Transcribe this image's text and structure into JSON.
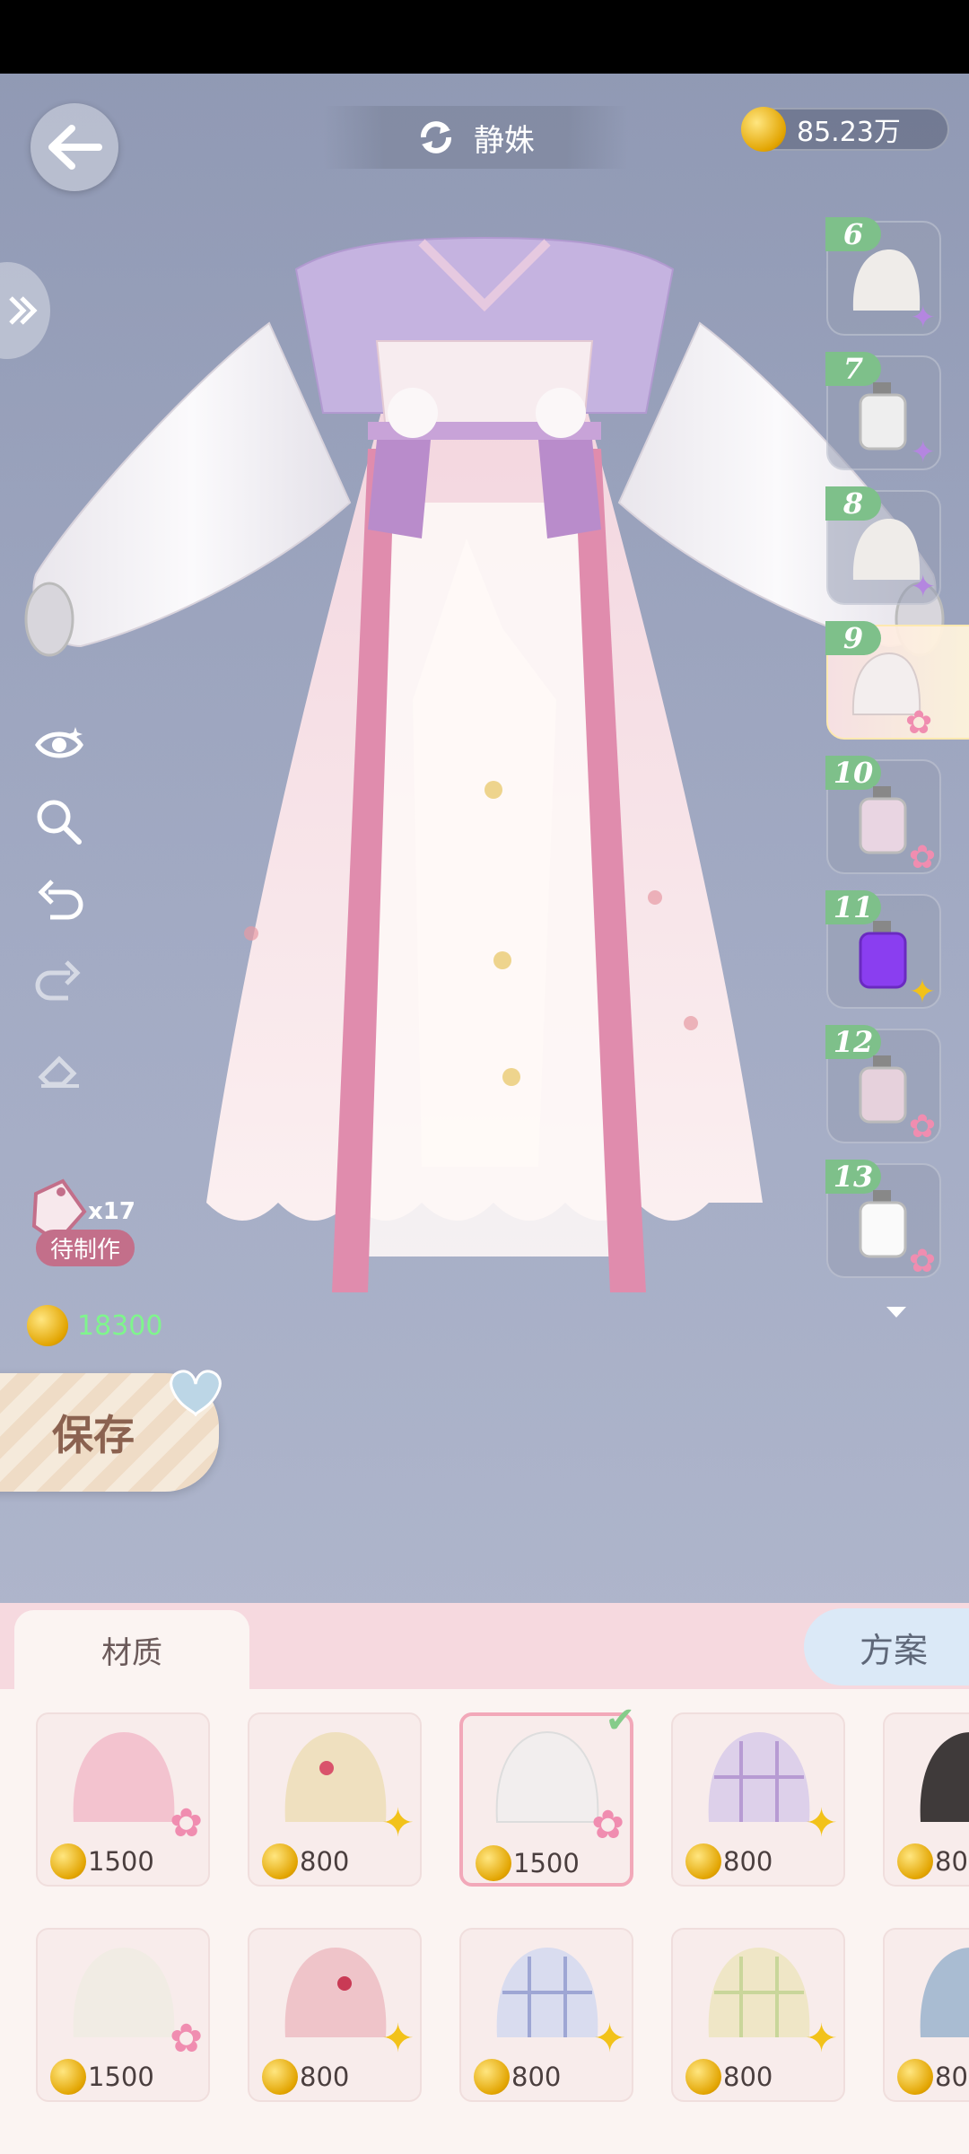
{
  "header": {
    "title": "静姝",
    "coin_balance": "85.23万"
  },
  "left_tools": {
    "craft_count": "x17",
    "craft_label": "待制作",
    "cost": "18300",
    "save_label": "保存"
  },
  "rail": {
    "slots": [
      {
        "num": "6",
        "item": "cape",
        "rarity": "purple"
      },
      {
        "num": "7",
        "item": "bottle",
        "rarity": "purple"
      },
      {
        "num": "8",
        "item": "cape",
        "rarity": "purple"
      },
      {
        "num": "9",
        "item": "shirt",
        "rarity": "rainbow",
        "selected": true
      },
      {
        "num": "10",
        "item": "bottle",
        "rarity": "rainbow"
      },
      {
        "num": "11",
        "item": "bottle",
        "rarity": "gold"
      },
      {
        "num": "12",
        "item": "bottle",
        "rarity": "rainbow"
      },
      {
        "num": "13",
        "item": "bottle",
        "rarity": "rainbow"
      }
    ]
  },
  "panel": {
    "tab_material": "材质",
    "tab_plan": "方案",
    "materials": [
      {
        "price": "1500",
        "pattern": "pink-bear",
        "rarity": "rainbow"
      },
      {
        "price": "800",
        "pattern": "cream-strawberry",
        "rarity": "gold"
      },
      {
        "price": "1500",
        "pattern": "white-floral",
        "rarity": "rainbow",
        "selected": true
      },
      {
        "price": "800",
        "pattern": "lilac-plaid",
        "rarity": "gold"
      },
      {
        "price": "80",
        "pattern": "black-patch",
        "rarity": "gold"
      },
      {
        "price": "1500",
        "pattern": "white-botanical",
        "rarity": "rainbow"
      },
      {
        "price": "800",
        "pattern": "pink-strawberry",
        "rarity": "gold"
      },
      {
        "price": "800",
        "pattern": "blue-plaid",
        "rarity": "gold"
      },
      {
        "price": "800",
        "pattern": "yellow-plaid",
        "rarity": "gold"
      },
      {
        "price": "80",
        "pattern": "blue-patch",
        "rarity": "gold"
      }
    ]
  },
  "icons": [
    "back-arrow-icon",
    "refresh-icon",
    "coin-icon",
    "double-chevron-icon",
    "eye-icon",
    "zoom-icon",
    "undo-icon",
    "redo-icon",
    "eraser-icon",
    "tag-icon",
    "check-icon",
    "chevron-down-icon"
  ]
}
